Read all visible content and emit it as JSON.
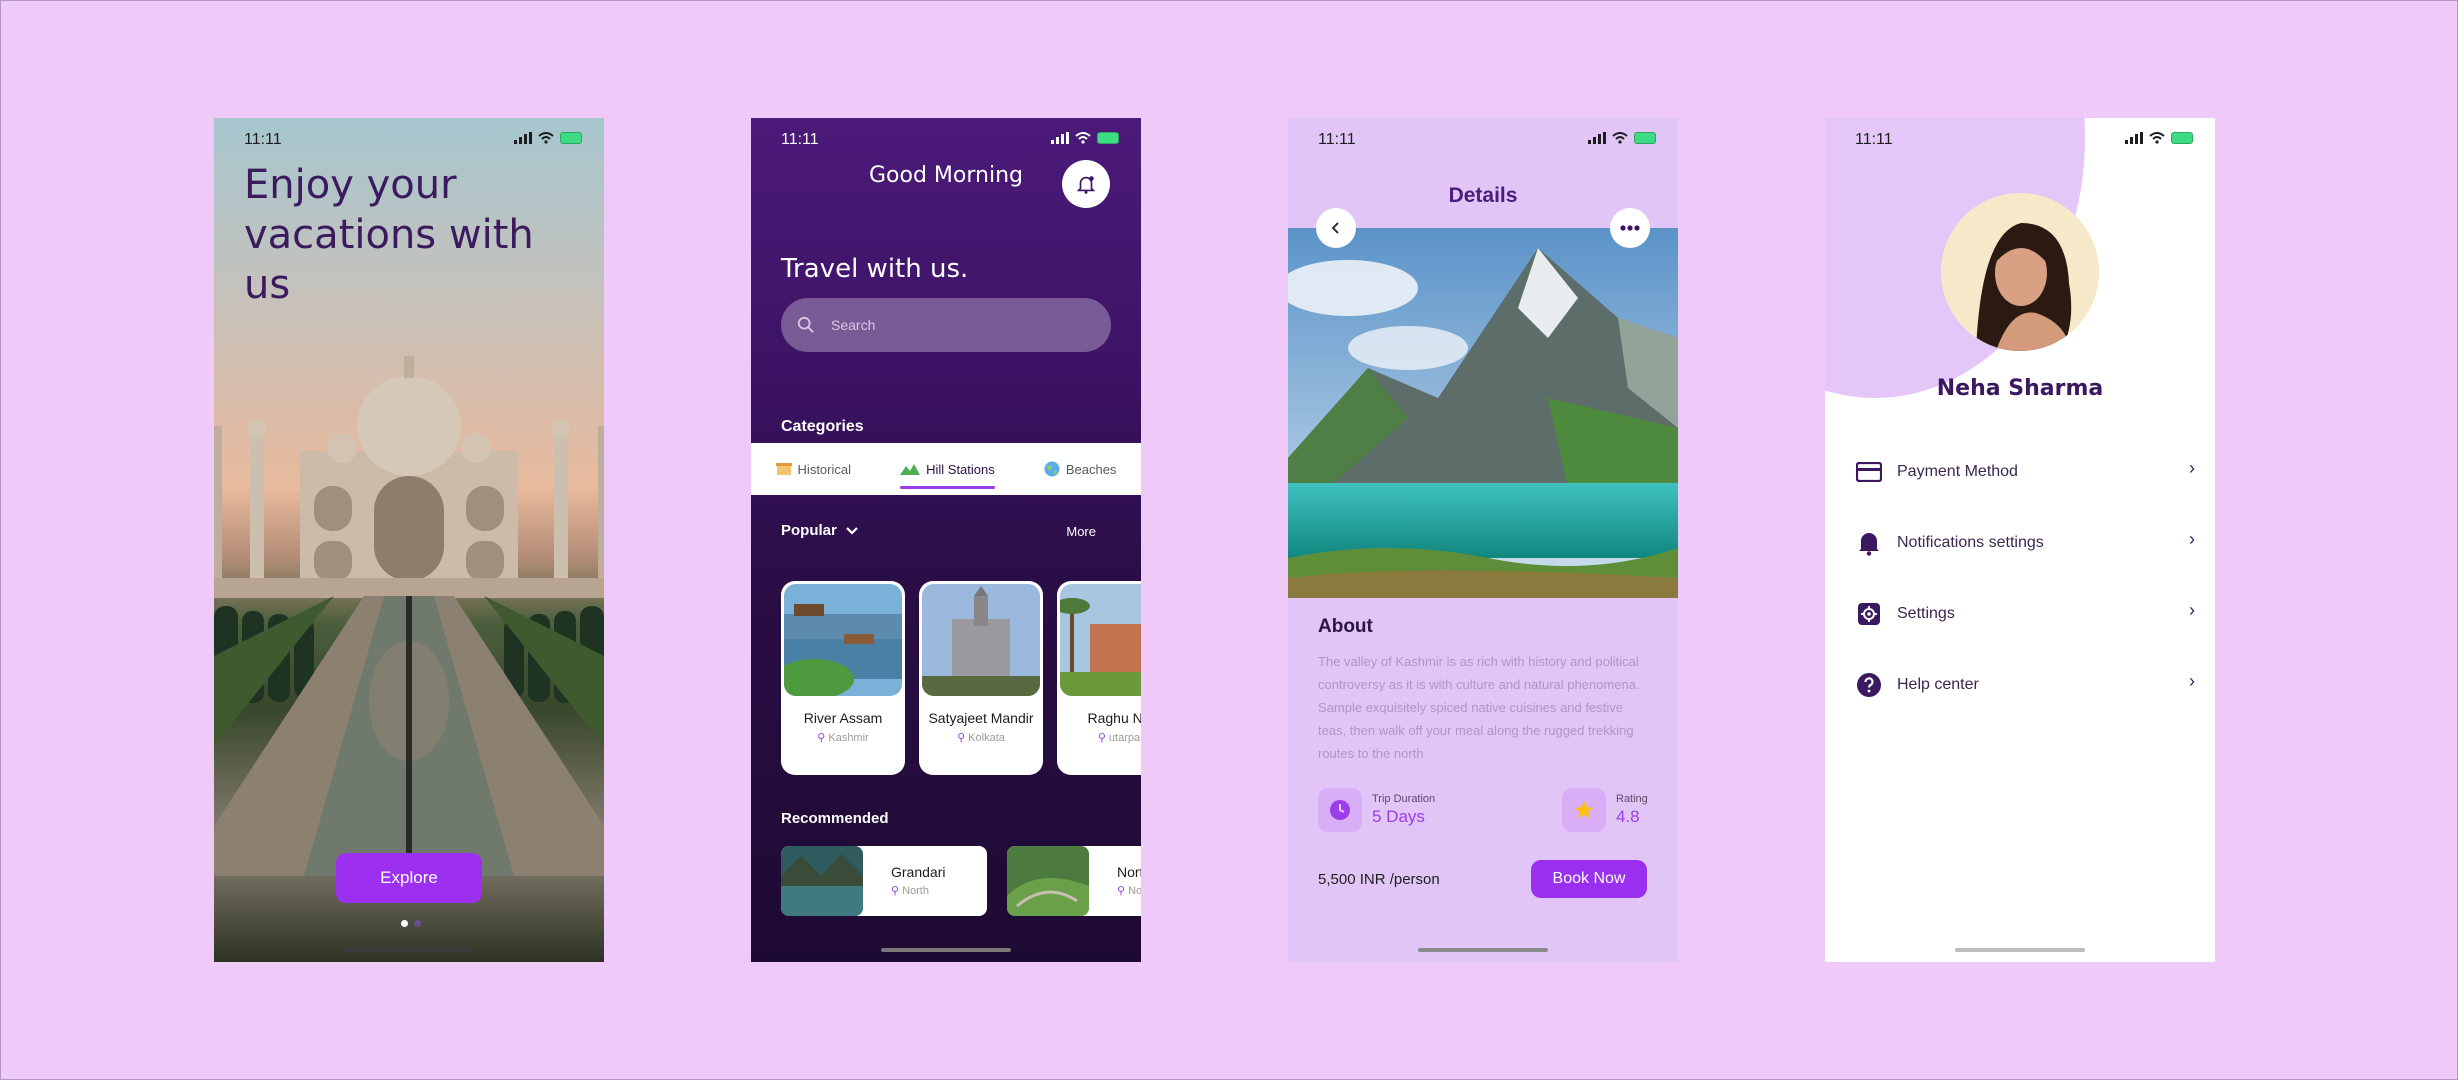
{
  "status": {
    "time": "11:11"
  },
  "onboarding": {
    "title": "Enjoy your vacations with us",
    "explore_label": "Explore"
  },
  "home": {
    "greeting": "Good Morning",
    "headline": "Travel with us.",
    "search_placeholder": "Search",
    "categories_heading": "Categories",
    "categories": [
      {
        "label": "Historical",
        "icon": "building-icon",
        "active": false
      },
      {
        "label": "Hill Stations",
        "icon": "mountain-icon",
        "active": true
      },
      {
        "label": "Beaches",
        "icon": "globe-icon",
        "active": false
      }
    ],
    "popular_heading": "Popular",
    "more_label": "More",
    "popular": [
      {
        "name": "River Assam",
        "location": "Kashmir"
      },
      {
        "name": "Satyajeet Mandir",
        "location": "Kolkata"
      },
      {
        "name": "Raghu Na",
        "location": "utarpa"
      }
    ],
    "recommended_heading": "Recommended",
    "recommended": [
      {
        "name": "Grandari",
        "location": "North"
      },
      {
        "name": "Nort",
        "location": "No"
      }
    ]
  },
  "details": {
    "title": "Details",
    "about_heading": "About",
    "about_text": "The valley of Kashmir is as rich with history and political controversy as it is with culture and natural phenomena. Sample exquisitely spiced native cuisines and festive teas, then walk off your meal along the rugged trekking routes to the north",
    "duration_label": "Trip Duration",
    "duration_value": "5 Days",
    "rating_label": "Rating",
    "rating_value": "4.8",
    "price": "5,500 INR /person",
    "book_label": "Book Now"
  },
  "profile": {
    "name": "Neha Sharma",
    "menu": [
      {
        "label": "Payment Method",
        "icon": "credit-card-icon"
      },
      {
        "label": "Notifications settings",
        "icon": "bell-icon"
      },
      {
        "label": "Settings",
        "icon": "gear-icon"
      },
      {
        "label": "Help center",
        "icon": "help-icon"
      }
    ]
  },
  "colors": {
    "background": "#efcaf9",
    "accent": "#9b2ff0",
    "deep_purple": "#3c1364",
    "text_purple": "#3a1961"
  }
}
